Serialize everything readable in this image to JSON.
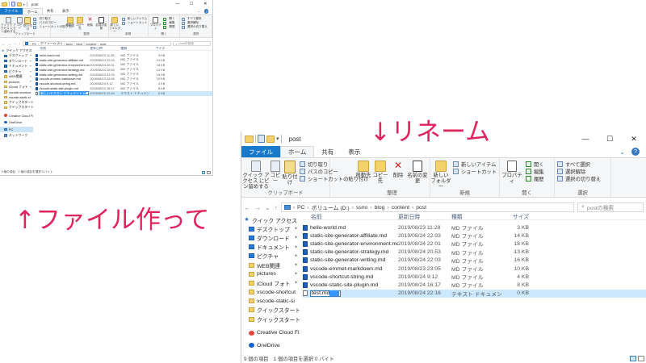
{
  "annotations": {
    "rename": "↓リネーム",
    "create": "↑ファイル作って"
  },
  "explorer": {
    "title": "post",
    "window_controls": [
      "—",
      "☐",
      "✕"
    ],
    "tabs": [
      "ファイル",
      "ホーム",
      "共有",
      "表示"
    ],
    "ribbon": {
      "pin_label": "クイック アクセス にピン留めする",
      "copy": "コピー",
      "paste": "貼り付け",
      "cut": "切り取り",
      "copy_path": "パスのコピー",
      "paste_shortcut": "ショートカットの貼り付け",
      "move_to": "移動先",
      "copy_to": "コピー先",
      "delete": "削除",
      "rename": "名前の変更",
      "new_folder": "新しい フォルダー",
      "new_item": "新しいアイテム",
      "easy_access": "ショートカット",
      "properties": "プロパティ",
      "open": "開く",
      "edit": "編集",
      "history": "履歴",
      "select_all": "すべて選択",
      "select_none": "選択解除",
      "invert_selection": "選択の切り替え",
      "group_clipboard": "クリップボード",
      "group_organize": "整理",
      "group_new": "新規",
      "group_open": "開く",
      "group_select": "選択"
    },
    "address": {
      "crumbs": [
        "PC",
        "ボリューム (D:)",
        "ssno",
        "blog",
        "content",
        "post"
      ],
      "search_placeholder": "postの検索"
    },
    "nav": [
      {
        "label": "クイック アクセス",
        "icon": "star-icon",
        "pin": false,
        "sel": false
      },
      {
        "label": "デスクトップ",
        "icon": "desktop-icon",
        "pin": true,
        "sel": false
      },
      {
        "label": "ダウンロード",
        "icon": "download-icon",
        "pin": true,
        "sel": false
      },
      {
        "label": "ドキュメント",
        "icon": "documents-icon",
        "pin": true,
        "sel": false
      },
      {
        "label": "ピクチャ",
        "icon": "pictures-icon",
        "pin": true,
        "sel": false
      },
      {
        "label": "WEB関連",
        "icon": "folder-icon",
        "pin": true,
        "sel": false
      },
      {
        "label": "pictures",
        "icon": "folder-icon",
        "pin": true,
        "sel": false
      },
      {
        "label": "iCloud フォト",
        "icon": "folder-icon",
        "pin": true,
        "sel": false
      },
      {
        "label": "vscode-shortcut",
        "icon": "folder-icon",
        "pin": false,
        "sel": false
      },
      {
        "label": "vscode-static-si",
        "icon": "folder-icon",
        "pin": false,
        "sel": false
      },
      {
        "label": "クイックスタート",
        "icon": "folder-icon",
        "pin": false,
        "sel": false
      },
      {
        "label": "クイックスタート",
        "icon": "folder-icon",
        "pin": false,
        "sel": false
      },
      {
        "label": "Creative Cloud File",
        "icon": "creative-cloud-icon",
        "pin": false,
        "sel": false
      },
      {
        "label": "OneDrive",
        "icon": "onedrive-icon",
        "pin": false,
        "sel": false
      },
      {
        "label": "PC",
        "icon": "pc-icon",
        "pin": false,
        "sel": true
      },
      {
        "label": "ネットワーク",
        "icon": "network-icon",
        "pin": false,
        "sel": false
      }
    ],
    "columns": {
      "name": "名前",
      "date": "更新日時",
      "type": "種類",
      "size": "サイズ"
    },
    "files": [
      {
        "name": "hello-world.md",
        "date": "2019/08/23 11:28",
        "type": "MD ファイル",
        "size": "3 KB"
      },
      {
        "name": "static-site-generator-affiliate.md",
        "date": "2019/08/24 22:03",
        "type": "MD ファイル",
        "size": "14 KB"
      },
      {
        "name": "static-site-generator-environment.md",
        "date": "2019/08/24 22:01",
        "type": "MD ファイル",
        "size": "18 KB"
      },
      {
        "name": "static-site-generator-strategy.md",
        "date": "2019/08/24 20:53",
        "type": "MD ファイル",
        "size": "13 KB"
      },
      {
        "name": "static-site-generator-writing.md",
        "date": "2019/08/24 22:03",
        "type": "MD ファイル",
        "size": "16 KB"
      },
      {
        "name": "vscode-emmet-markdown.md",
        "date": "2019/08/23 23:05",
        "type": "MD ファイル",
        "size": "10 KB"
      },
      {
        "name": "vscode-shortcut-string.md",
        "date": "2019/08/24 9:12",
        "type": "MD ファイル",
        "size": "4 KB"
      },
      {
        "name": "vscode-static-site-plugin.md",
        "date": "2019/08/24 16:17",
        "type": "MD ファイル",
        "size": "8 KB"
      }
    ],
    "new_file_before": {
      "edit_text": "新しいテキスト ドキュメント.txt",
      "date": "2019/08/24 22:16",
      "type": "テキスト ドキュメント",
      "size": "0 KB"
    },
    "new_file_after": {
      "edit_text": "test.md",
      "date": "2019/08/24 22:16",
      "type": "テキスト ドキュメント",
      "size": "0 KB"
    },
    "status": "9 個の項目　1 個の項目を選択 0 バイト"
  },
  "colors": {
    "accent": "#1979ca",
    "annotation": "#e0245e",
    "selection": "#cce8ff"
  }
}
